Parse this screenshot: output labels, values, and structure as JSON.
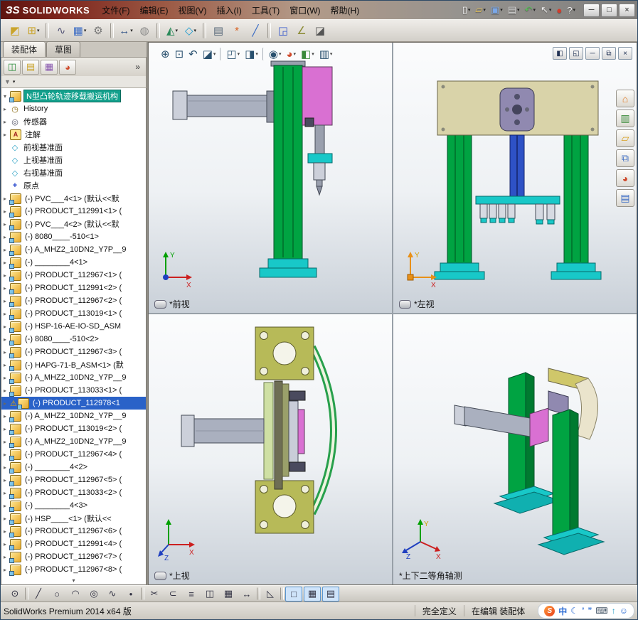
{
  "colors": {
    "column_green": "#00a342",
    "base_teal": "#18c8c8",
    "panel_magenta": "#d970d2",
    "beam_tan": "#d9d3a9",
    "actuator_blue": "#2e52c6",
    "arm_gray": "#aab0bf",
    "flange_olive": "#b7ba58",
    "selection_blue": "#2a62c8",
    "root_highlight": "#12a08c",
    "titlebar_red": "#7d241c"
  },
  "titlebar": {
    "logo": "ЗS",
    "brand": "SOLIDWORKS",
    "menus": [
      "文件(F)",
      "编辑(E)",
      "视图(V)",
      "插入(I)",
      "工具(T)",
      "窗口(W)",
      "帮助(H)"
    ],
    "quick_icons": [
      {
        "name": "new-document-icon",
        "glyph": "▯",
        "color": "#f4f4f4",
        "caret": true
      },
      {
        "name": "open-document-icon",
        "glyph": "▱",
        "color": "#e8c24a",
        "caret": true
      },
      {
        "name": "save-icon",
        "glyph": "▣",
        "color": "#7aa7e8",
        "caret": true
      },
      {
        "name": "print-icon",
        "glyph": "▤",
        "color": "#d8d8d8",
        "caret": true
      },
      {
        "name": "undo-icon",
        "glyph": "↶",
        "color": "#58c058",
        "caret": true
      },
      {
        "name": "select-icon",
        "glyph": "↖",
        "color": "#f0f0f0",
        "caret": true
      },
      {
        "name": "rebuild-icon",
        "glyph": "●",
        "color": "#d23c2c"
      },
      {
        "name": "help-icon",
        "glyph": "?",
        "color": "#f0f0f0",
        "caret": true
      }
    ],
    "window_buttons": {
      "minimize": "─",
      "maximize": "□",
      "close": "×"
    }
  },
  "toolbar": {
    "icons": [
      {
        "name": "edit-component-icon",
        "glyph": "◩",
        "color": "#caa42c"
      },
      {
        "name": "insert-components-icon",
        "glyph": "⊞",
        "color": "#caa42c",
        "caret": true
      },
      {
        "sep": true
      },
      {
        "name": "mate-icon",
        "glyph": "∿",
        "color": "#555577"
      },
      {
        "name": "component-pattern-icon",
        "glyph": "▦",
        "color": "#3a6bc4",
        "caret": true
      },
      {
        "name": "smart-fasteners-icon",
        "glyph": "⚙",
        "color": "#777777"
      },
      {
        "sep": true
      },
      {
        "name": "move-component-icon",
        "glyph": "↔",
        "color": "#335588",
        "caret": true
      },
      {
        "name": "show-hidden-components-icon",
        "glyph": "◍",
        "color": "#888888"
      },
      {
        "sep": true
      },
      {
        "name": "assembly-features-icon",
        "glyph": "◭",
        "color": "#2a8a5a",
        "caret": true
      },
      {
        "name": "reference-geometry-icon",
        "glyph": "◇",
        "color": "#1a9bd0",
        "caret": true
      },
      {
        "sep": true
      },
      {
        "name": "bill-of-materials-icon",
        "glyph": "▤",
        "color": "#556677"
      },
      {
        "name": "exploded-view-icon",
        "glyph": "*",
        "color": "#d86020"
      },
      {
        "name": "explode-line-sketch-icon",
        "glyph": "╱",
        "color": "#3a6bc4"
      },
      {
        "sep": true
      },
      {
        "name": "interference-detection-icon",
        "glyph": "◲",
        "color": "#3355cc"
      },
      {
        "name": "measure-icon",
        "glyph": "∠",
        "color": "#8a8a33"
      },
      {
        "name": "section-view-icon",
        "glyph": "◪",
        "color": "#555555"
      }
    ]
  },
  "cmdtabs": [
    {
      "label": "装配体",
      "active": true
    },
    {
      "label": "草图",
      "active": false
    }
  ],
  "panel": {
    "pane_icons": [
      {
        "name": "featuremanager-tab-icon",
        "glyph": "◫",
        "color": "#2a8a3a"
      },
      {
        "name": "propertymanager-tab-icon",
        "glyph": "▤",
        "color": "#caa42c"
      },
      {
        "name": "configurationmanager-tab-icon",
        "glyph": "▦",
        "color": "#8a5ab0"
      },
      {
        "name": "displaymanager-tab-icon",
        "glyph": "◕",
        "color": "#cf4a2c"
      }
    ],
    "expand_glyph": "»",
    "filter_glyph": "▼"
  },
  "tree": {
    "root": {
      "label": "N型凸轮轨迹移载搬运机构"
    },
    "scroll_more": "▾",
    "items": [
      {
        "icon": "history",
        "label": "History",
        "exp": true
      },
      {
        "icon": "sensor",
        "label": "传感器",
        "exp": true
      },
      {
        "icon": "annotation",
        "label": "注解",
        "exp": true
      },
      {
        "icon": "plane",
        "label": "前视基准面"
      },
      {
        "icon": "plane",
        "label": "上视基准面"
      },
      {
        "icon": "plane",
        "label": "右视基准面"
      },
      {
        "icon": "origin",
        "label": "原点"
      },
      {
        "icon": "asm",
        "label": "(-) PVC___4<1> (默认<<默",
        "exp": true
      },
      {
        "icon": "asm",
        "label": "(-) PRODUCT_112991<1> (",
        "exp": true
      },
      {
        "icon": "asm",
        "label": "(-) PVC___4<2> (默认<<默",
        "exp": true
      },
      {
        "icon": "asm",
        "label": "(-) 8080____-510<1>",
        "exp": true
      },
      {
        "icon": "asm",
        "label": "(-) A_MHZ2_10DN2_Y7P__9",
        "exp": true
      },
      {
        "icon": "asm",
        "label": "(-) ________4<1>",
        "exp": true
      },
      {
        "icon": "asm",
        "label": "(-) PRODUCT_112967<1> (",
        "exp": true
      },
      {
        "icon": "asm",
        "label": "(-) PRODUCT_112991<2> (",
        "exp": true
      },
      {
        "icon": "asm",
        "label": "(-) PRODUCT_112967<2> (",
        "exp": true
      },
      {
        "icon": "asm",
        "label": "(-) PRODUCT_113019<1> (",
        "exp": true
      },
      {
        "icon": "asm",
        "label": "(-) HSP-16-AE-IO-SD_ASM",
        "exp": true
      },
      {
        "icon": "asm",
        "label": "(-) 8080____-510<2>",
        "exp": true
      },
      {
        "icon": "asm",
        "label": "(-) PRODUCT_112967<3> (",
        "exp": true
      },
      {
        "icon": "asm",
        "label": "(-) HAPG-71-B_ASM<1> (默",
        "exp": true
      },
      {
        "icon": "asm",
        "label": "(-) A_MHZ2_10DN2_Y7P__9",
        "exp": true
      },
      {
        "icon": "asm",
        "label": "(-) PRODUCT_113033<1> (",
        "exp": true
      },
      {
        "icon": "asm",
        "label": "(-) PRODUCT_112978<1",
        "exp": true,
        "selected": true,
        "warning": true
      },
      {
        "icon": "asm",
        "label": "(-) A_MHZ2_10DN2_Y7P__9",
        "exp": true
      },
      {
        "icon": "asm",
        "label": "(-) PRODUCT_113019<2> (",
        "exp": true
      },
      {
        "icon": "asm",
        "label": "(-) A_MHZ2_10DN2_Y7P__9",
        "exp": true
      },
      {
        "icon": "asm",
        "label": "(-) PRODUCT_112967<4> (",
        "exp": true
      },
      {
        "icon": "asm",
        "label": "(-) ________4<2>",
        "exp": true
      },
      {
        "icon": "asm",
        "label": "(-) PRODUCT_112967<5> (",
        "exp": true
      },
      {
        "icon": "asm",
        "label": "(-) PRODUCT_113033<2> (",
        "exp": true
      },
      {
        "icon": "asm",
        "label": "(-) ________4<3>",
        "exp": true
      },
      {
        "icon": "asm",
        "label": "(-) HSP____<1> (默认<<",
        "exp": true
      },
      {
        "icon": "asm",
        "label": "(-) PRODUCT_112967<6> (",
        "exp": true
      },
      {
        "icon": "asm",
        "label": "(-) PRODUCT_112991<4> (",
        "exp": true
      },
      {
        "icon": "asm",
        "label": "(-) PRODUCT_112967<7> (",
        "exp": true
      },
      {
        "icon": "asm",
        "label": "(-) PRODUCT_112967<8> (",
        "exp": true
      }
    ]
  },
  "headsup": {
    "icons": [
      {
        "name": "zoom-fit-icon",
        "glyph": "⊕"
      },
      {
        "name": "zoom-area-icon",
        "glyph": "⊡"
      },
      {
        "name": "previous-view-icon",
        "glyph": "↶"
      },
      {
        "name": "section-view-icon",
        "glyph": "◪",
        "caret": true
      },
      {
        "sep": true
      },
      {
        "name": "view-orientation-icon",
        "glyph": "◰",
        "caret": true
      },
      {
        "name": "display-style-icon",
        "glyph": "◨",
        "caret": true
      },
      {
        "sep": true
      },
      {
        "name": "hide-show-items-icon",
        "glyph": "◉",
        "caret": true
      },
      {
        "name": "edit-appearance-icon",
        "glyph": "◕",
        "color": "#cf4a2c",
        "caret": true
      },
      {
        "name": "apply-scene-icon",
        "glyph": "◧",
        "color": "#3a8a3a",
        "caret": true
      },
      {
        "name": "view-settings-icon",
        "glyph": "▥",
        "caret": true
      }
    ]
  },
  "docwin": {
    "items": [
      {
        "name": "viewport-single-icon",
        "glyph": "◧"
      },
      {
        "name": "viewport-multi-icon",
        "glyph": "◱"
      },
      {
        "name": "doc-minimize-button",
        "glyph": "─"
      },
      {
        "name": "doc-restore-button",
        "glyph": "⧉"
      },
      {
        "name": "doc-close-button",
        "glyph": "×"
      }
    ]
  },
  "taskpane": {
    "icons": [
      {
        "name": "resources-home-icon",
        "glyph": "⌂",
        "color": "#e07820"
      },
      {
        "name": "design-library-icon",
        "glyph": "▥",
        "color": "#3a8a3a"
      },
      {
        "name": "file-explorer-icon",
        "glyph": "▱",
        "color": "#d8a020"
      },
      {
        "name": "view-palette-icon",
        "glyph": "⧉",
        "color": "#3a6bc4"
      },
      {
        "name": "appearances-icon",
        "glyph": "◕",
        "color": "#cf4a2c"
      },
      {
        "name": "custom-properties-icon",
        "glyph": "▤",
        "color": "#3a6bc4"
      }
    ]
  },
  "views": {
    "front": {
      "label": "*前视"
    },
    "left": {
      "label": "*左视"
    },
    "top": {
      "label": "*上视"
    },
    "iso": {
      "label": "*上下二等角轴测"
    }
  },
  "triads": {
    "front": {
      "x": "X",
      "y": "Y"
    },
    "left": {
      "x": "X",
      "y": "Y"
    },
    "top": {
      "x": "X",
      "z": "Z"
    },
    "iso": {
      "x": "X",
      "y": "Y",
      "z": "Z"
    }
  },
  "sketchbar": {
    "icons": [
      {
        "name": "select-tool-icon",
        "glyph": "⊙"
      },
      {
        "sep": true
      },
      {
        "name": "line-tool-icon",
        "glyph": "╱"
      },
      {
        "name": "circle-tool-icon",
        "glyph": "○"
      },
      {
        "name": "arc-tool-icon",
        "glyph": "◠"
      },
      {
        "name": "ellipse-tool-icon",
        "glyph": "◎"
      },
      {
        "name": "spline-tool-icon",
        "glyph": "∿"
      },
      {
        "name": "point-tool-icon",
        "glyph": "•"
      },
      {
        "sep": true
      },
      {
        "name": "trim-entities-icon",
        "glyph": "✂"
      },
      {
        "name": "convert-entities-icon",
        "glyph": "⊂"
      },
      {
        "name": "offset-entities-icon",
        "glyph": "≡"
      },
      {
        "name": "mirror-entities-icon",
        "glyph": "◫"
      },
      {
        "name": "linear-pattern-icon",
        "glyph": "▦"
      },
      {
        "name": "move-entities-icon",
        "glyph": "↔"
      },
      {
        "sep": true
      },
      {
        "name": "chamfer-tool-icon",
        "glyph": "◺"
      },
      {
        "sep": true
      },
      {
        "name": "grid-system-icon",
        "glyph": "□",
        "active": true
      },
      {
        "name": "snap-grid-icon",
        "glyph": "▦",
        "active": true
      },
      {
        "name": "instant2d-icon",
        "glyph": "▤",
        "active": true
      }
    ]
  },
  "statusbar": {
    "product": "SolidWorks Premium 2014 x64 版",
    "state": "完全定义",
    "mode": "在编辑 装配体",
    "tray": [
      {
        "name": "sogou-icon",
        "glyph": "S",
        "color": "#ffffff"
      },
      {
        "name": "ime-mode-icon",
        "glyph": "中",
        "color": "#2a6bd4"
      },
      {
        "name": "ime-moon-icon",
        "glyph": "☾",
        "color": "#2a6bd4"
      },
      {
        "name": "ime-punct-icon",
        "glyph": "’",
        "color": "#2a6bd4"
      },
      {
        "name": "ime-quote-icon",
        "glyph": "”",
        "color": "#2a6bd4"
      },
      {
        "name": "ime-keyboard-icon",
        "glyph": "⌨",
        "color": "#445566"
      },
      {
        "name": "ime-up-icon",
        "glyph": "↑",
        "color": "#2aa0c8"
      },
      {
        "name": "ime-user-icon",
        "glyph": "☺",
        "color": "#2a6bd4"
      }
    ]
  }
}
